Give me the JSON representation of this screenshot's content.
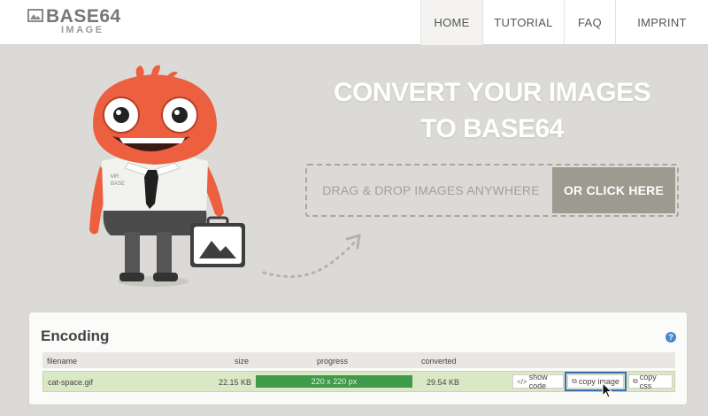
{
  "header": {
    "logo_title": "BASE64",
    "logo_subtitle": "IMAGE",
    "nav": [
      {
        "label": "HOME",
        "active": true
      },
      {
        "label": "TUTORIAL",
        "active": false
      },
      {
        "label": "FAQ",
        "active": false
      },
      {
        "label": "IMPRINT",
        "active": false
      }
    ]
  },
  "hero": {
    "title_line1": "CONVERT YOUR IMAGES",
    "title_line2": "TO BASE64",
    "drop_label": "DRAG & DROP IMAGES ANYWHERE",
    "click_label": "OR CLICK HERE",
    "mascot_shirt_text_line1": "MR",
    "mascot_shirt_text_line2": "BASE"
  },
  "encoding": {
    "title": "Encoding",
    "help_icon": "question-circle-icon",
    "columns": {
      "filename": "filename",
      "size": "size",
      "progress": "progress",
      "converted": "converted"
    },
    "rows": [
      {
        "filename": "cat-space.gif",
        "size": "22.15 KB",
        "progress_label": "220 x 220 px",
        "progress_fraction": 1.0,
        "converted": "29.54 KB",
        "show_code_label": "show code",
        "copy_image_label": "copy image",
        "copy_css_label": "copy css"
      }
    ]
  },
  "colors": {
    "page_bg": "#dcdad6",
    "accent_button": "#9d9a8f",
    "mascot_orange": "#ec5f3f",
    "progress_green": "#3f9a4a",
    "row_bg": "#dbe8c5",
    "highlight_blue": "#3a6fb0"
  }
}
